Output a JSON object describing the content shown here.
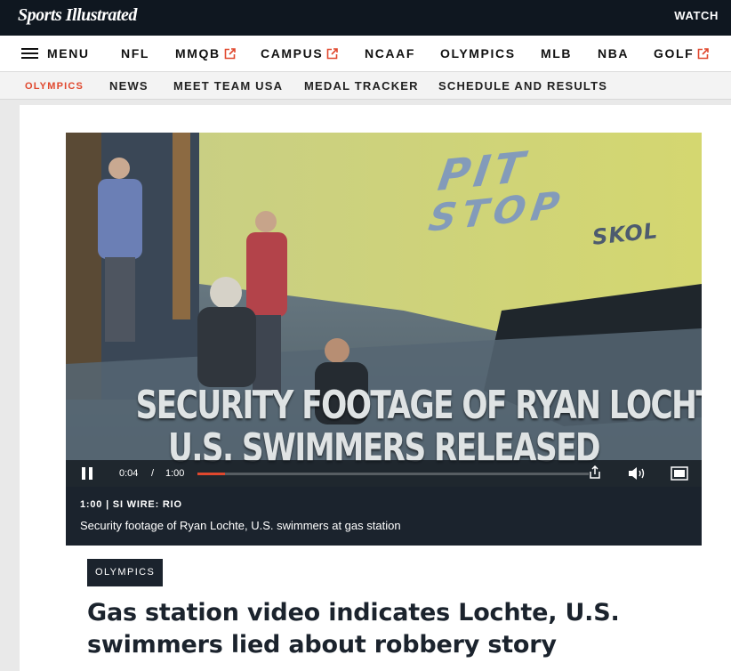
{
  "header": {
    "logo_text": "Sports Illustrated",
    "watch_label": "WATCH"
  },
  "main_nav": {
    "menu_label": "MENU",
    "items": [
      {
        "label": "NFL",
        "external": false
      },
      {
        "label": "MMQB",
        "external": true
      },
      {
        "label": "CAMPUS",
        "external": true
      },
      {
        "label": "NCAAF",
        "external": false
      },
      {
        "label": "OLYMPICS",
        "external": false
      },
      {
        "label": "MLB",
        "external": false
      },
      {
        "label": "NBA",
        "external": false
      },
      {
        "label": "GOLF",
        "external": true
      }
    ],
    "external_icon_color": "#e0482e"
  },
  "sub_nav": {
    "items": [
      {
        "label": "OLYMPICS",
        "active": true
      },
      {
        "label": "NEWS",
        "active": false
      },
      {
        "label": "MEET TEAM USA",
        "active": false
      },
      {
        "label": "MEDAL TRACKER",
        "active": false
      },
      {
        "label": "SCHEDULE AND RESULTS",
        "active": false
      }
    ],
    "active_color": "#e0482e"
  },
  "video": {
    "overlay_line1": "SECURITY FOOTAGE OF RYAN LOCHTE,",
    "overlay_line2": "U.S. SWIMMERS RELEASED",
    "sign_line1": "PIT",
    "sign_line2": "STOP",
    "sign_brand": "SKOL",
    "current_time": "0:04",
    "time_separator": "/",
    "duration": "1:00",
    "progress": 0.07,
    "progress_color": "#e0482e",
    "meta": "1:00 | SI WIRE: RIO",
    "description": "Security footage of Ryan Lochte, U.S. swimmers at gas station"
  },
  "article": {
    "category_tag": "OLYMPICS",
    "headline": "Gas station video indicates Lochte, U.S. swimmers lied about robbery story"
  }
}
